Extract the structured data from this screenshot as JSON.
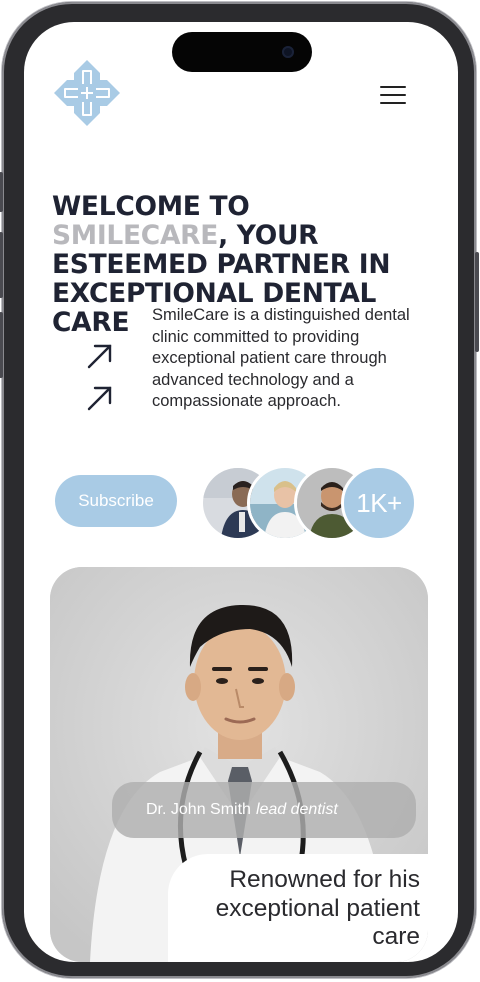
{
  "brand": {
    "logo_icon": "plus-cross-logo-icon",
    "accent_color": "#a9cbe5",
    "dark_color": "#1f2333"
  },
  "header": {
    "menu_icon": "hamburger-menu-icon"
  },
  "hero": {
    "headline_prefix": "WELCOME TO ",
    "headline_accent": "SMILECARE",
    "headline_rest": ", YOUR ESTEEMED PARTNER IN EXCEPTIONAL DENTAL CARE",
    "description": "SmileCare is a distinguished dental clinic committed to providing exceptional patient care through advanced technology and a compassionate approach.",
    "arrow_icons": [
      "arrow-up-right-icon",
      "arrow-up-right-icon"
    ]
  },
  "cta": {
    "subscribe_label": "Subscribe",
    "subscriber_count": "1K+"
  },
  "doctor": {
    "name": "Dr. John Smith",
    "role": "lead dentist",
    "tagline": "Renowned for his exceptional patient care"
  }
}
